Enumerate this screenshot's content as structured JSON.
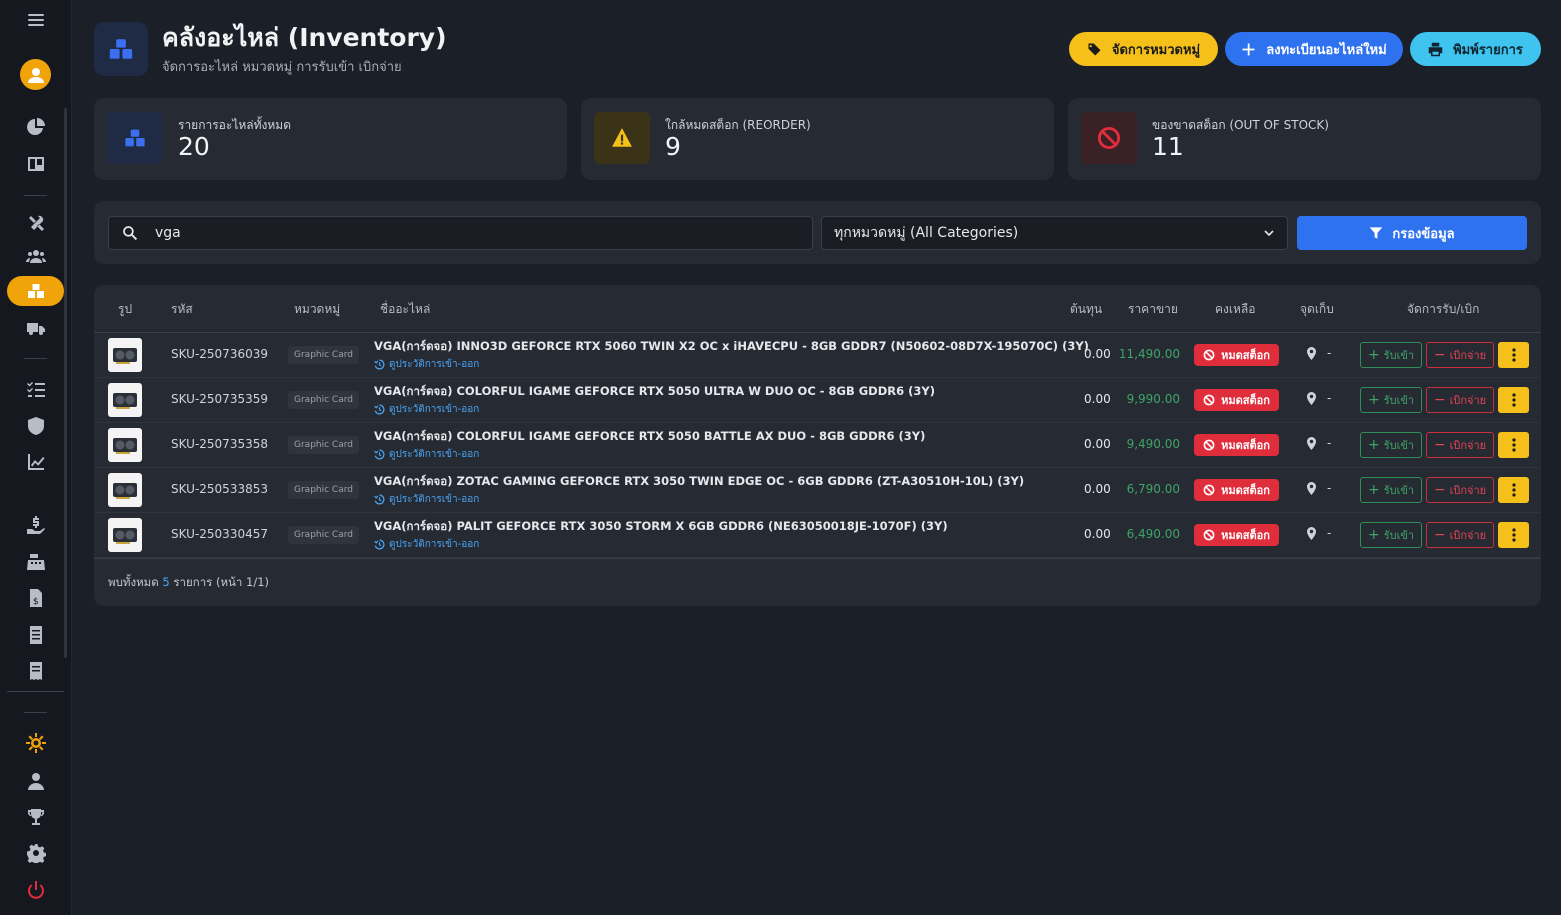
{
  "page": {
    "title": "คลังอะไหล่ (Inventory)",
    "subtitle": "จัดการอะไหล่ หมวดหมู่ การรับเข้า เบิกจ่าย"
  },
  "actions": {
    "manage_categories": "จัดการหมวดหมู่",
    "register_new": "ลงทะเบียนอะไหล่ใหม่",
    "print_list": "พิมพ์รายการ"
  },
  "stats": [
    {
      "label": "รายการอะไหล่ทั้งหมด",
      "value": "20",
      "icon": "boxes-icon",
      "color": "#3b6ff0"
    },
    {
      "label": "ใกล้หมดสต็อก (REORDER)",
      "value": "9",
      "icon": "warning-icon",
      "color": "#f5c01a"
    },
    {
      "label": "ของขาดสต็อก (OUT OF STOCK)",
      "value": "11",
      "icon": "ban-icon",
      "color": "#e02d3c"
    }
  ],
  "filter": {
    "search_value": "vga",
    "category_selected": "ทุกหมวดหมู่ (All Categories)",
    "filter_button": "กรองข้อมูล"
  },
  "table": {
    "headers": {
      "image": "รูป",
      "sku": "รหัส",
      "category": "หมวดหมู่",
      "name": "ชื่ออะไหล่",
      "cost": "ต้นทุน",
      "price": "ราคาขาย",
      "remaining": "คงเหลือ",
      "location": "จุดเก็บ",
      "manage": "จัดการรับ/เบิก"
    },
    "history_link": "ดูประวัติการเข้า-ออก",
    "out_of_stock_label": "หมดสต็อก",
    "receive_label": "รับเข้า",
    "issue_label": "เบิกจ่าย",
    "rows": [
      {
        "sku": "SKU-250736039",
        "category": "Graphic Card",
        "name": "VGA(การ์ดจอ) INNO3D GEFORCE RTX 5060 TWIN X2 OC x iHAVECPU - 8GB GDDR7 (N50602-08D7X-195070C) (3Y)",
        "cost": "0.00",
        "price": "11,490.00",
        "location": "-"
      },
      {
        "sku": "SKU-250735359",
        "category": "Graphic Card",
        "name": "VGA(การ์ดจอ) COLORFUL IGAME GEFORCE RTX 5050 ULTRA W DUO OC - 8GB GDDR6 (3Y)",
        "cost": "0.00",
        "price": "9,990.00",
        "location": "-"
      },
      {
        "sku": "SKU-250735358",
        "category": "Graphic Card",
        "name": "VGA(การ์ดจอ) COLORFUL IGAME GEFORCE RTX 5050 BATTLE AX DUO - 8GB GDDR6 (3Y)",
        "cost": "0.00",
        "price": "9,490.00",
        "location": "-"
      },
      {
        "sku": "SKU-250533853",
        "category": "Graphic Card",
        "name": "VGA(การ์ดจอ) ZOTAC GAMING GEFORCE RTX 3050 TWIN EDGE OC - 6GB GDDR6 (ZT-A30510H-10L) (3Y)",
        "cost": "0.00",
        "price": "6,790.00",
        "location": "-"
      },
      {
        "sku": "SKU-250330457",
        "category": "Graphic Card",
        "name": "VGA(การ์ดจอ) PALIT GEFORCE RTX 3050 STORM X 6GB GDDR6 (NE63050018JE-1070F) (3Y)",
        "cost": "0.00",
        "price": "6,490.00",
        "location": "-"
      }
    ]
  },
  "footer": {
    "prefix": "พบทั้งหมด",
    "count": "5",
    "suffix": "รายการ (หน้า 1/1)"
  }
}
